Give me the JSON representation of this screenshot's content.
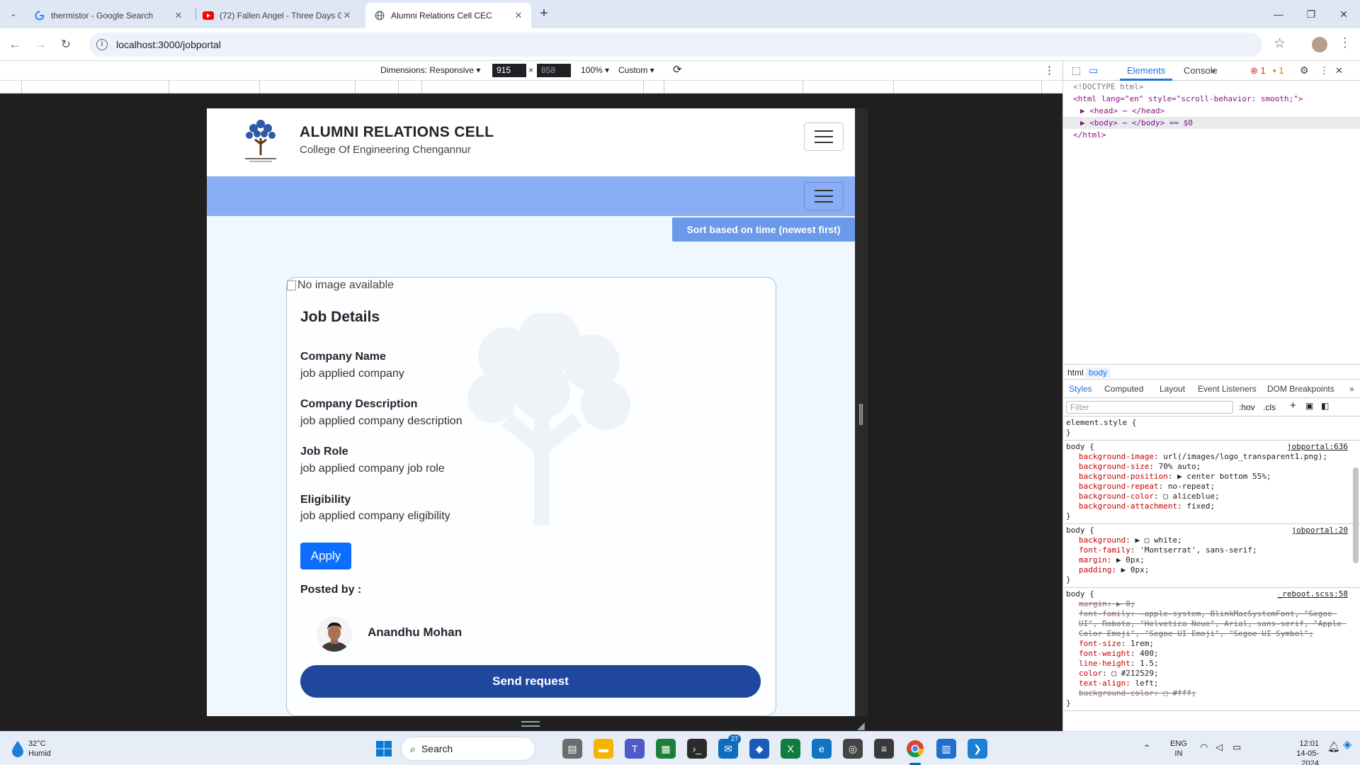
{
  "browser": {
    "tabs": [
      {
        "title": "thermistor - Google Search",
        "icon": "google-icon"
      },
      {
        "title": "(72) Fallen Angel - Three Days Grace",
        "icon": "youtube-icon"
      },
      {
        "title": "Alumni Relations Cell CEC",
        "icon": "globe-icon",
        "active": true
      }
    ],
    "url": "localhost:3000/jobportal",
    "window_controls": [
      "minimize",
      "restore",
      "close"
    ]
  },
  "device_toolbar": {
    "dimensions_label": "Dimensions: Responsive",
    "width": "915",
    "height": "858",
    "times": "×",
    "zoom": "100%",
    "throttle": "Custom"
  },
  "site": {
    "title": "ALUMNI RELATIONS CELL",
    "subtitle": "College Of Engineering Chengannur",
    "sort_button": "Sort based on time (newest first)",
    "card": {
      "image_alt": "No image available",
      "heading": "Job Details",
      "fields": [
        {
          "label": "Company Name",
          "value": "job applied company"
        },
        {
          "label": "Company Description",
          "value": "job applied company description"
        },
        {
          "label": "Job Role",
          "value": "job applied company job role"
        },
        {
          "label": "Eligibility",
          "value": "job applied company eligibility"
        }
      ],
      "apply_label": "Apply",
      "posted_by_label": "Posted by :",
      "poster_name": "Anandhu Mohan",
      "send_request_label": "Send request"
    }
  },
  "devtools": {
    "tabs": [
      "Elements",
      "Console"
    ],
    "more": "»",
    "errors": "1",
    "warnings": "1",
    "html_lines": [
      "<!DOCTYPE html>",
      "<html lang=\"en\" style=\"scroll-behavior: smooth;\">",
      "▶ <head> ⋯ </head>",
      "▶ <body> ⋯ </body> == $0",
      "</html>"
    ],
    "breadcrumbs": [
      "html",
      "body"
    ],
    "subtabs": [
      "Styles",
      "Computed",
      "Layout",
      "Event Listeners",
      "DOM Breakpoints"
    ],
    "filter_placeholder": "Filter",
    "filter_tools": [
      ":hov",
      ".cls"
    ],
    "rules": [
      {
        "selector": "element.style {",
        "source": "",
        "decls": [],
        "close": "}"
      },
      {
        "selector": "body {",
        "source": "jobportal:636",
        "decls": [
          {
            "prop": "background-image",
            "val": "url(/images/logo_transparent1.png);"
          },
          {
            "prop": "background-size",
            "val": "70% auto;"
          },
          {
            "prop": "background-position",
            "val": "▶ center bottom 55%;"
          },
          {
            "prop": "background-repeat",
            "val": "no-repeat;"
          },
          {
            "prop": "background-color",
            "val": "▢ aliceblue;"
          },
          {
            "prop": "background-attachment",
            "val": "fixed;"
          }
        ],
        "close": "}"
      },
      {
        "selector": "body {",
        "source": "jobportal:20",
        "decls": [
          {
            "prop": "background",
            "val": "▶ ▢ white;"
          },
          {
            "prop": "font-family",
            "val": "'Montserrat', sans-serif;"
          },
          {
            "prop": "margin",
            "val": "▶ 0px;"
          },
          {
            "prop": "padding",
            "val": "▶ 0px;"
          }
        ],
        "close": "}"
      },
      {
        "selector": "body {",
        "source": "_reboot.scss:58",
        "decls": [
          {
            "prop": "margin",
            "val": "▶ 0;",
            "strike": true
          },
          {
            "prop": "font-family",
            "val": "-apple-system, BlinkMacSystemFont, \"Segoe UI\", Roboto, \"Helvetica Neue\", Arial, sans-serif, \"Apple Color Emoji\", \"Segoe UI Emoji\", \"Segoe UI Symbol\";",
            "strike": true
          },
          {
            "prop": "font-size",
            "val": "1rem;"
          },
          {
            "prop": "font-weight",
            "val": "400;"
          },
          {
            "prop": "line-height",
            "val": "1.5;"
          },
          {
            "prop": "color",
            "val": "▢ #212529;"
          },
          {
            "prop": "text-align",
            "val": "left;"
          },
          {
            "prop": "background-color",
            "val": "▢ #fff;",
            "strike": true
          }
        ],
        "close": "}"
      }
    ]
  },
  "taskbar": {
    "temperature": "32°C",
    "condition": "Humid",
    "search_label": "Search",
    "mail_badge": "27",
    "lang_top": "ENG",
    "lang_bottom": "IN",
    "time": "12:01",
    "date": "14-05-2024"
  }
}
